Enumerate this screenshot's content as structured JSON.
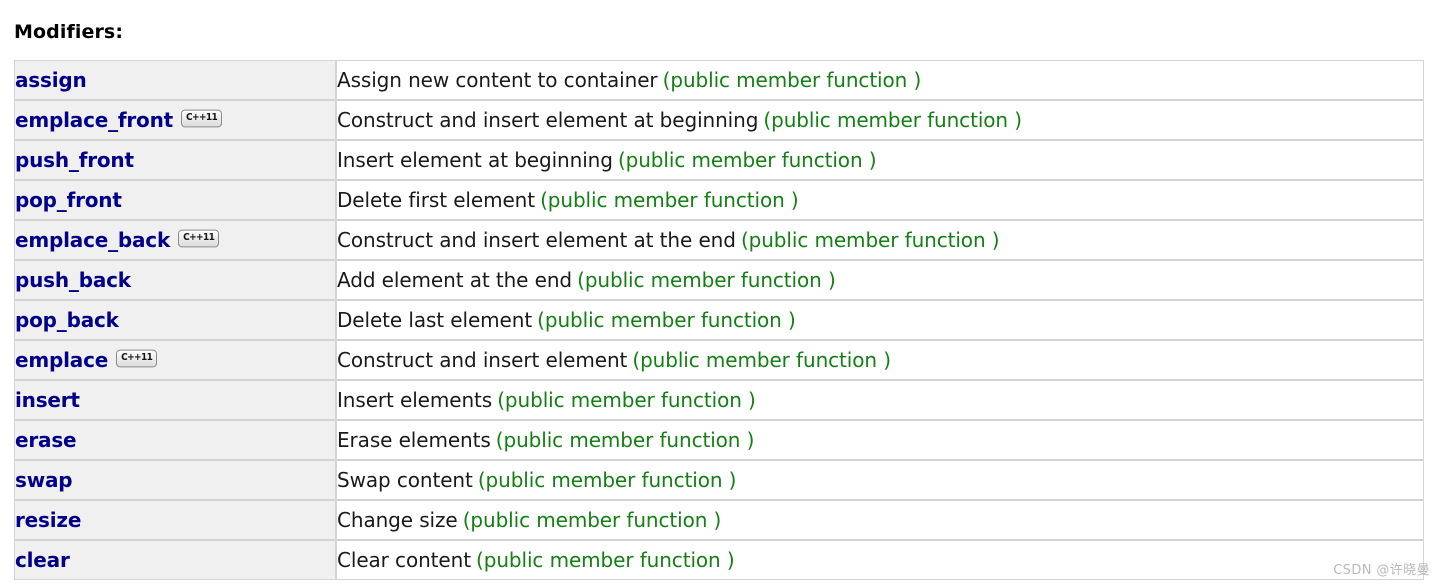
{
  "page": {
    "title": "Modifiers:",
    "watermark": "CSDN @许晓曼"
  },
  "colors": {
    "link_blue": "#00008b",
    "kind_green": "#138013",
    "name_cell_bg": "#f0f0f0",
    "border": "#d4d4d4",
    "text_black": "#1a1a1a",
    "watermark_gray": "#b9b9b9"
  },
  "table": {
    "badge_label": "C++11",
    "badge_icon_name": "cxx11-badge-icon",
    "rows": [
      {
        "name": "assign",
        "badge": false,
        "description": "Assign new content to container",
        "kind": "(public member function )"
      },
      {
        "name": "emplace_front",
        "badge": true,
        "description": "Construct and insert element at beginning",
        "kind": "(public member function )"
      },
      {
        "name": "push_front",
        "badge": false,
        "description": "Insert element at beginning",
        "kind": "(public member function )"
      },
      {
        "name": "pop_front",
        "badge": false,
        "description": "Delete first element",
        "kind": "(public member function )"
      },
      {
        "name": "emplace_back",
        "badge": true,
        "description": "Construct and insert element at the end",
        "kind": "(public member function )"
      },
      {
        "name": "push_back",
        "badge": false,
        "description": "Add element at the end",
        "kind": "(public member function )"
      },
      {
        "name": "pop_back",
        "badge": false,
        "description": "Delete last element",
        "kind": "(public member function )"
      },
      {
        "name": "emplace",
        "badge": true,
        "description": "Construct and insert element",
        "kind": "(public member function )"
      },
      {
        "name": "insert",
        "badge": false,
        "description": "Insert elements",
        "kind": "(public member function )"
      },
      {
        "name": "erase",
        "badge": false,
        "description": "Erase elements",
        "kind": "(public member function )"
      },
      {
        "name": "swap",
        "badge": false,
        "description": "Swap content",
        "kind": "(public member function )"
      },
      {
        "name": "resize",
        "badge": false,
        "description": "Change size",
        "kind": "(public member function )"
      },
      {
        "name": "clear",
        "badge": false,
        "description": "Clear content",
        "kind": "(public member function )"
      }
    ]
  }
}
